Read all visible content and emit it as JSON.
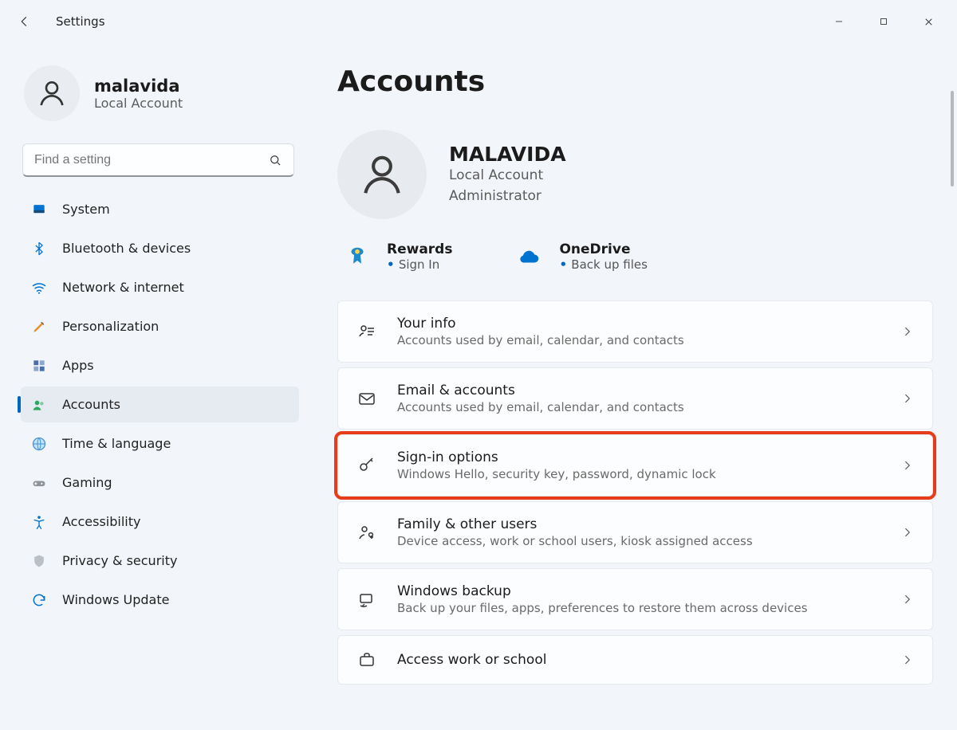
{
  "window": {
    "title": "Settings"
  },
  "sidebar": {
    "user": {
      "name": "malavida",
      "sub": "Local Account"
    },
    "search": {
      "placeholder": "Find a setting"
    },
    "nav": [
      {
        "id": "system",
        "label": "System",
        "icon": "system-icon",
        "active": false
      },
      {
        "id": "bluetooth",
        "label": "Bluetooth & devices",
        "icon": "bluetooth-icon",
        "active": false
      },
      {
        "id": "network",
        "label": "Network & internet",
        "icon": "wifi-icon",
        "active": false
      },
      {
        "id": "personalization",
        "label": "Personalization",
        "icon": "brush-icon",
        "active": false
      },
      {
        "id": "apps",
        "label": "Apps",
        "icon": "apps-icon",
        "active": false
      },
      {
        "id": "accounts",
        "label": "Accounts",
        "icon": "accounts-icon",
        "active": true
      },
      {
        "id": "time",
        "label": "Time & language",
        "icon": "globe-icon",
        "active": false
      },
      {
        "id": "gaming",
        "label": "Gaming",
        "icon": "gamepad-icon",
        "active": false
      },
      {
        "id": "accessibility",
        "label": "Accessibility",
        "icon": "accessibility-icon",
        "active": false
      },
      {
        "id": "privacy",
        "label": "Privacy & security",
        "icon": "shield-icon",
        "active": false
      },
      {
        "id": "update",
        "label": "Windows Update",
        "icon": "update-icon",
        "active": false
      }
    ]
  },
  "page": {
    "title": "Accounts",
    "hero": {
      "name": "MALAVIDA",
      "sub1": "Local Account",
      "sub2": "Administrator"
    },
    "tiles": [
      {
        "id": "rewards",
        "title": "Rewards",
        "sub": "Sign In",
        "icon": "rewards-icon"
      },
      {
        "id": "onedrive",
        "title": "OneDrive",
        "sub": "Back up files",
        "icon": "cloud-icon"
      }
    ],
    "cards": [
      {
        "id": "your-info",
        "title": "Your info",
        "sub": "Accounts used by email, calendar, and contacts",
        "icon": "your-info-icon",
        "highlight": false
      },
      {
        "id": "email",
        "title": "Email & accounts",
        "sub": "Accounts used by email, calendar, and contacts",
        "icon": "mail-icon",
        "highlight": false
      },
      {
        "id": "signin",
        "title": "Sign-in options",
        "sub": "Windows Hello, security key, password, dynamic lock",
        "icon": "key-icon",
        "highlight": true
      },
      {
        "id": "family",
        "title": "Family & other users",
        "sub": "Device access, work or school users, kiosk assigned access",
        "icon": "family-icon",
        "highlight": false
      },
      {
        "id": "backup",
        "title": "Windows backup",
        "sub": "Back up your files, apps, preferences to restore them across devices",
        "icon": "backup-icon",
        "highlight": false
      },
      {
        "id": "work",
        "title": "Access work or school",
        "sub": "",
        "icon": "briefcase-icon",
        "highlight": false
      }
    ]
  }
}
